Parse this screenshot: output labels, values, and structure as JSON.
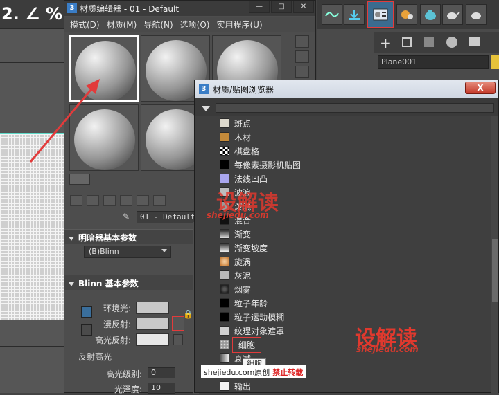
{
  "viewport": {
    "toolbar_glyphs": [
      "2.",
      "∠",
      "%"
    ],
    "grid_color": "#cfcfcf",
    "border_color": "#5fd9c8"
  },
  "main_toolbar": {
    "icons": [
      "curve-editor-icon",
      "render-setup-icon",
      "material-editor-icon",
      "render-frame-icon",
      "render-icon",
      "teapot-icon"
    ]
  },
  "command_panel": {
    "tabs": [
      "create-icon",
      "modify-icon",
      "hierarchy-icon",
      "motion-icon",
      "display-icon",
      "utilities-icon"
    ],
    "object_name": "Plane001",
    "object_color": "#e6c23a"
  },
  "material_editor": {
    "title": "材质编辑器 - 01 - Default",
    "menu": [
      "模式(D)",
      "材质(M)",
      "导航(N)",
      "选项(O)",
      "实用程序(U)"
    ],
    "slot_count": 6,
    "material_name": "01 - Default",
    "shader_rollout": "明暗器基本参数",
    "shader_value": "(B)Blinn",
    "blinn_rollout": "Blinn 基本参数",
    "ambient_label": "环境光:",
    "diffuse_label": "漫反射:",
    "specular_label": "高光反射:",
    "highlight_group": "反射高光",
    "spec_level_label": "高光级别:",
    "spec_level_value": "0",
    "gloss_label": "光泽度:",
    "gloss_value": "10"
  },
  "browser": {
    "title": "材质/贴图浏览器",
    "close_label": "X",
    "items": [
      {
        "label": "斑点",
        "thumb": "#dcd8cc"
      },
      {
        "label": "木材",
        "thumb": "#c48a3a"
      },
      {
        "label": "棋盘格",
        "thumb": "checker"
      },
      {
        "label": "每像素摄影机贴图",
        "thumb": "#000000"
      },
      {
        "label": "法线凹凸",
        "thumb": "#a9a6ee"
      },
      {
        "label": "波浪",
        "thumb": "#bdbdbd"
      },
      {
        "label": "泼溅",
        "thumb": "#9a9a9a"
      },
      {
        "label": "混合",
        "thumb": "#111111"
      },
      {
        "label": "渐变",
        "thumb": "#777777"
      },
      {
        "label": "渐变坡度",
        "thumb": "#9a9a9a"
      },
      {
        "label": "旋涡",
        "thumb": "#e0a070"
      },
      {
        "label": "灰泥",
        "thumb": "#b8b8b8"
      },
      {
        "label": "烟雾",
        "thumb": "#333333"
      },
      {
        "label": "粒子年龄",
        "thumb": "#000000"
      },
      {
        "label": "粒子运动模糊",
        "thumb": "#000000"
      },
      {
        "label": "纹理对象遮罩",
        "thumb": "#cfcfcf"
      },
      {
        "label": "细胞",
        "thumb": "#c9c9c9"
      },
      {
        "label": "衰减",
        "thumb": "#aaaaaa"
      },
      {
        "label": "输出",
        "thumb": "#f2f2f2"
      }
    ],
    "selected_index": 16,
    "tooltip": "细胞"
  },
  "watermark": {
    "brand": "设解读",
    "site": "shejiedu.com",
    "source_prefix": "shejiedu.com原创",
    "source_warning": "禁止转载"
  }
}
